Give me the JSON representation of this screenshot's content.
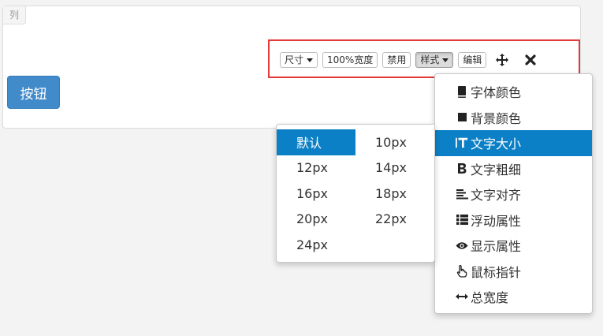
{
  "column": {
    "tag_label": "列"
  },
  "button": {
    "label": "按钮",
    "color": "#428bca"
  },
  "toolbar": {
    "highlight_color": "#e33b3b",
    "size_label": "尺寸",
    "full_width_label": "100%宽度",
    "disable_label": "禁用",
    "style_label": "样式",
    "edit_label": "编辑",
    "move_icon": "move-icon",
    "remove_icon": "close-icon"
  },
  "style_menu": {
    "active_color": "#0c80c6",
    "items": [
      {
        "label": "字体颜色",
        "icon": "book-icon"
      },
      {
        "label": "背景颜色",
        "icon": "square-icon"
      },
      {
        "label": "文字大小",
        "icon": "text-height-icon",
        "active": true
      },
      {
        "label": "文字粗细",
        "icon": "bold-icon"
      },
      {
        "label": "文字对齐",
        "icon": "align-left-icon"
      },
      {
        "label": "浮动属性",
        "icon": "list-icon"
      },
      {
        "label": "显示属性",
        "icon": "eye-icon"
      },
      {
        "label": "鼠标指针",
        "icon": "hand-pointer-icon"
      },
      {
        "label": "总宽度",
        "icon": "resize-horizontal-icon"
      }
    ]
  },
  "size_submenu": {
    "options": [
      {
        "label": "默认",
        "active": true
      },
      {
        "label": "10px"
      },
      {
        "label": "12px"
      },
      {
        "label": "14px"
      },
      {
        "label": "16px"
      },
      {
        "label": "18px"
      },
      {
        "label": "20px"
      },
      {
        "label": "22px"
      },
      {
        "label": "24px"
      }
    ]
  }
}
